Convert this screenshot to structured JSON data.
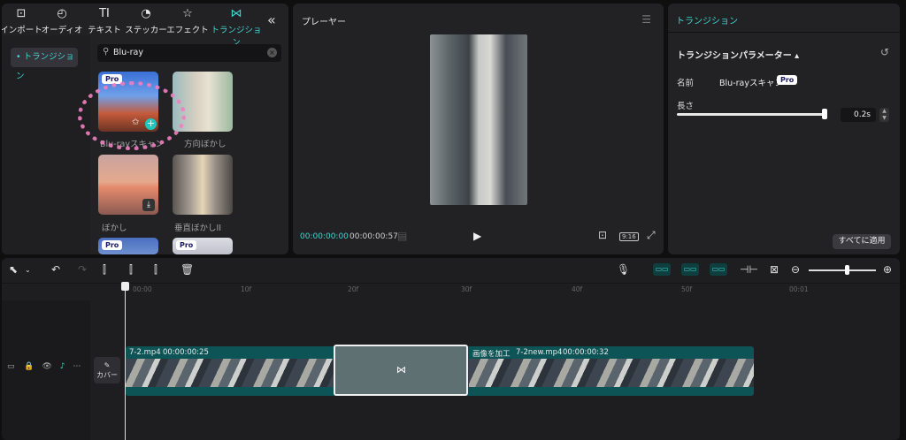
{
  "top_tabs": [
    {
      "icon": "⊡",
      "label": "インポート"
    },
    {
      "icon": "◴",
      "label": "オーディオ"
    },
    {
      "icon": "TI",
      "label": "テキスト"
    },
    {
      "icon": "◔",
      "label": "ステッカー"
    },
    {
      "icon": "☆",
      "label": "エフェクト"
    },
    {
      "icon": "⋈",
      "label": "トランジション"
    }
  ],
  "collapse_icon": "«",
  "sidebar": {
    "active": "• トランジション"
  },
  "search": {
    "value": "Blu-ray"
  },
  "tiles": [
    {
      "label": "Blu-rayスキャン",
      "pro": "Pro"
    },
    {
      "label": "方向ぼかし"
    },
    {
      "label": "ぼかし"
    },
    {
      "label": "垂直ぼかしII"
    },
    {
      "pro": "Pro"
    },
    {
      "pro": "Pro"
    }
  ],
  "player": {
    "title": "プレーヤー",
    "time_current": "00:00:00:00",
    "time_duration": "00:00:00:57",
    "ratio_label": "9:16"
  },
  "properties": {
    "header": "トランジション",
    "section": "トランジションパラメーター ▴",
    "name_label": "名前",
    "name_value": "Blu-rayスキャン",
    "name_badge": "Pro",
    "length_label": "長さ",
    "length_value": "0.2s",
    "apply_all": "すべてに適用"
  },
  "ruler": [
    "00:00",
    "10f",
    "20f",
    "30f",
    "40f",
    "50f",
    "00:01"
  ],
  "timeline": {
    "cover_label": "カバー",
    "clip1": {
      "name": "7-2.mp4",
      "duration": "00:00:00:25"
    },
    "clip2": {
      "prefix": "画像を加工",
      "name": "7-2new.mp4",
      "duration": "00:00:00:32"
    }
  },
  "colors": {
    "accent": "#3fd6d1",
    "panel": "#222225",
    "track": "#0d5457",
    "annotation_ring": "#f07fc0"
  }
}
